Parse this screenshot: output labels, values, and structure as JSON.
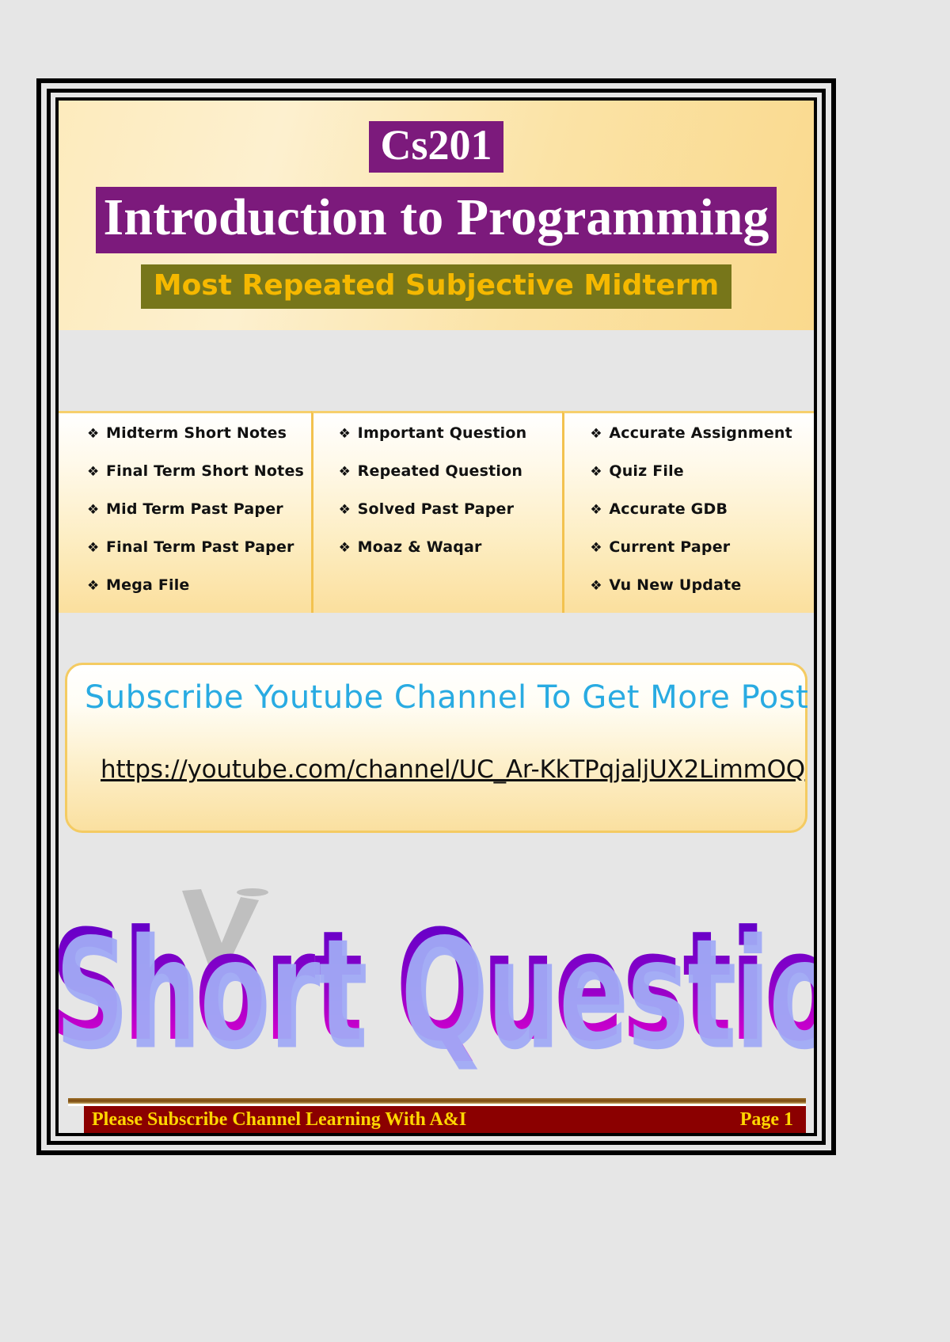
{
  "header": {
    "course_code": "Cs201",
    "course_title": "Introduction to Programming",
    "subtitle": "Most Repeated Subjective Midterm"
  },
  "bullet_glyph": "❖",
  "columns": [
    {
      "items": [
        "Midterm Short Notes",
        "Final Term Short Notes",
        "Mid Term Past Paper",
        "Final Term Past Paper",
        "Mega File"
      ]
    },
    {
      "items": [
        "Important Question",
        "Repeated Question",
        "Solved Past Paper",
        "Moaz & Waqar"
      ]
    },
    {
      "items": [
        "Accurate Assignment",
        "Quiz File",
        "Accurate GDB",
        "Current Paper",
        "Vu New Update"
      ]
    }
  ],
  "subscribe": {
    "title": "Subscribe Youtube Channel To Get More Post",
    "url": "https://youtube.com/channel/UC_Ar-KkTPqjaljUX2LimmOQ"
  },
  "wordart": {
    "text": "Short Question"
  },
  "footer": {
    "left_text": "Please Subscribe Channel Learning With A&I",
    "page_text": "Page 1"
  },
  "colors": {
    "purple_block": "#7c1a7c",
    "olive_block": "#77761a",
    "subtitle_text": "#f5b800",
    "cyan_heading": "#29abe2",
    "footer_bar": "#8b0000",
    "footer_text": "#ffd700",
    "page_background": "#e6e6e6",
    "banner_cream": "#fdebbd"
  }
}
